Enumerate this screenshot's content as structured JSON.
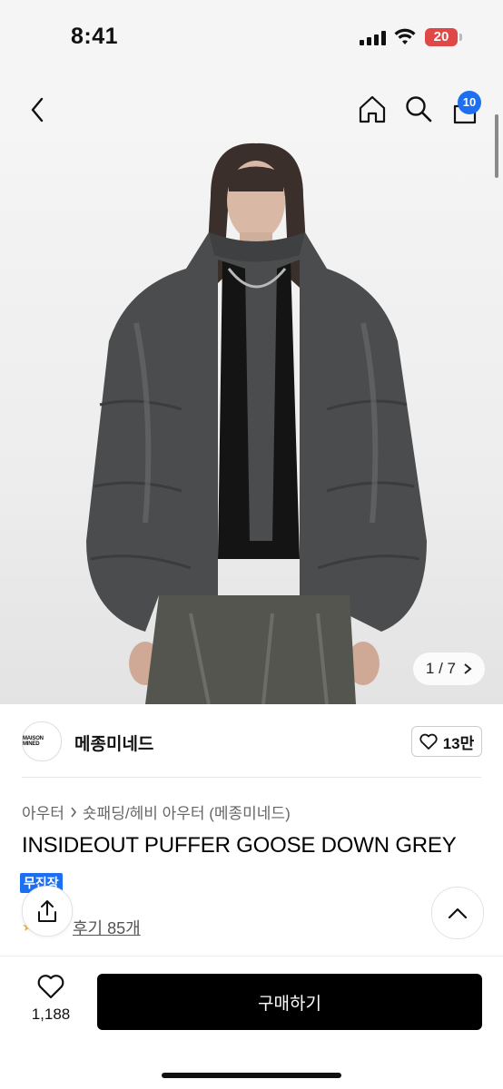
{
  "status_bar": {
    "time": "8:41",
    "battery": "20"
  },
  "nav": {
    "cart_count": "10",
    "icons": [
      "back-chevron-icon",
      "home-icon",
      "search-icon",
      "cart-icon"
    ]
  },
  "gallery": {
    "page_current": "1",
    "page_sep": "/",
    "page_total": "7"
  },
  "brand": {
    "logo_text": "MAISON MINED",
    "name": "메종미네드",
    "like_count": "13만"
  },
  "breadcrumb": {
    "category": "아우터",
    "subcategory": "숏패딩/헤비 아우터 (메종미네드)"
  },
  "product": {
    "title": "INSIDEOUT PUFFER GOOSE DOWN GREY",
    "tag": "무진장",
    "reviews": "후기 85개"
  },
  "bottom_bar": {
    "favorite_count": "1,188",
    "buy_label": "구매하기"
  },
  "colors": {
    "accent": "#1d6ff2",
    "battery": "#e04848",
    "buy": "#000000"
  }
}
